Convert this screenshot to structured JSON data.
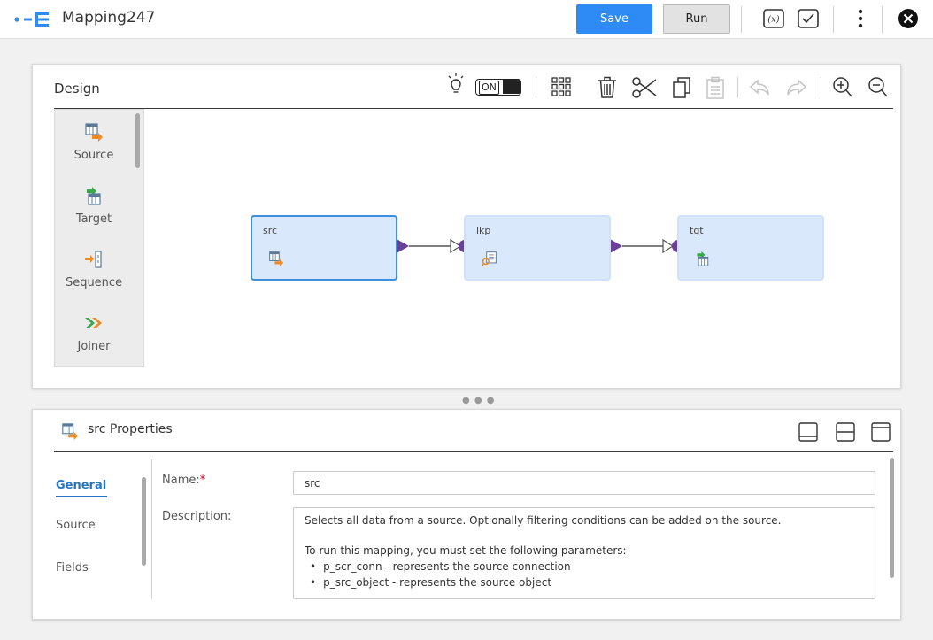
{
  "app": {
    "title": "Mapping247"
  },
  "toolbar": {
    "save_label": "Save",
    "run_label": "Run"
  },
  "design": {
    "title": "Design",
    "toggle_label": "ON",
    "palette": [
      {
        "label": "Source",
        "icon": "source-transform-icon"
      },
      {
        "label": "Target",
        "icon": "target-transform-icon"
      },
      {
        "label": "Sequence",
        "icon": "sequence-transform-icon"
      },
      {
        "label": "Joiner",
        "icon": "joiner-transform-icon"
      }
    ],
    "nodes": [
      {
        "label": "src",
        "icon": "source-transform-icon",
        "selected": true
      },
      {
        "label": "lkp",
        "icon": "lookup-transform-icon",
        "selected": false
      },
      {
        "label": "tgt",
        "icon": "target-transform-icon",
        "selected": false
      }
    ]
  },
  "properties": {
    "title": "src Properties",
    "tabs": [
      "General",
      "Source",
      "Fields"
    ],
    "active_tab": "General",
    "name_label": "Name:",
    "name_required": "*",
    "name_value": "src",
    "description_label": "Description:",
    "description_line1": "Selects all data from a source. Optionally filtering conditions can be added on the source.",
    "description_line2": "To run this mapping, you must set the following parameters:",
    "description_bullets": [
      "p_scr_conn - represents the source connection",
      "p_src_object - represents the source object"
    ]
  },
  "colors": {
    "accent": "#2e8bf5",
    "node_fill": "#d9e9fb",
    "node_selected_border": "#3e8fe0",
    "port": "#6c3f98",
    "source_arrow": "#f08a24",
    "target_arrow": "#3aa64b"
  }
}
